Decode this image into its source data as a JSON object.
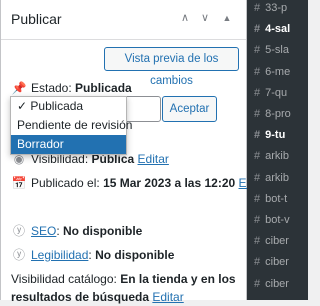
{
  "panel": {
    "title": "Publicar",
    "preview_button": "Vista previa de los cambios",
    "status_label": "Estado:",
    "status_value": "Publicada",
    "status_options": [
      "Publicada",
      "Pendiente de revisión",
      "Borrador"
    ],
    "accept_button": "Aceptar",
    "visibility_label": "Visibilidad:",
    "visibility_value": "Pública",
    "edit_link": "Editar",
    "published_label": "Publicado el:",
    "published_value": "15 Mar 2023 a las 12:20",
    "seo_link": "SEO",
    "seo_value": "No disponible",
    "legibility_link": "Legibilidad",
    "legibility_value": "No disponible",
    "catalog_label": "Visibilidad catálogo:",
    "catalog_value": "En la tienda y en los resultados de búsqueda"
  },
  "tags": [
    "33-p",
    "4-sal",
    "5-sla",
    "6-me",
    "7-qu",
    "8-pro",
    "9-tu",
    "arkib",
    "arkib",
    "bot-t",
    "bot-v",
    "ciber",
    "ciber",
    "ciber"
  ],
  "bold_tags": [
    1,
    6
  ]
}
